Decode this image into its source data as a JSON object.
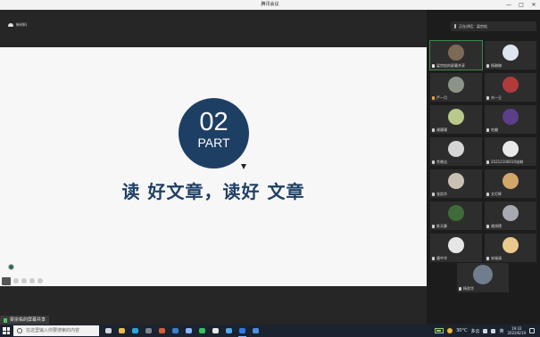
{
  "window": {
    "title": "腾讯会议",
    "controls": [
      "—",
      "□",
      "✕"
    ]
  },
  "logo": {
    "label": "新材料"
  },
  "slide": {
    "number": "02",
    "part": "PART",
    "title": "读 好文章，读好 文章"
  },
  "share_tag": {
    "label": "梁宗佑的屏幕共享"
  },
  "panel": {
    "speaking": "正在讲话：梁宗佑",
    "participants": [
      {
        "name": "梁宗佑的屏幕共享",
        "mic": "shield",
        "avatar_color": "#7c6a57",
        "active": true
      },
      {
        "name": "杨琳琳",
        "mic": "normal",
        "avatar_color": "#dfe5ee"
      },
      {
        "name": "严一月",
        "mic": "warn",
        "avatar_color": "#8c9488"
      },
      {
        "name": "刘一旦",
        "mic": "normal",
        "avatar_color": "#b33a3a"
      },
      {
        "name": "谢珊珊",
        "mic": "normal",
        "avatar_color": "#b9c98a"
      },
      {
        "name": "吃瓣",
        "mic": "normal",
        "avatar_color": "#5b3f8a"
      },
      {
        "name": "余晓洁",
        "mic": "normal",
        "avatar_color": "#d6d6d6"
      },
      {
        "name": "20212106010张琳",
        "mic": "normal",
        "avatar_color": "#e9e9e9"
      },
      {
        "name": "张凯华",
        "mic": "normal",
        "avatar_color": "#c9c2b4"
      },
      {
        "name": "文灯辉",
        "mic": "normal",
        "avatar_color": "#d2a86a"
      },
      {
        "name": "陈天静",
        "mic": "normal",
        "avatar_color": "#3f6a3a"
      },
      {
        "name": "谢润德",
        "mic": "normal",
        "avatar_color": "#a6a9b0"
      },
      {
        "name": "唐中华",
        "mic": "normal",
        "avatar_color": "#e6e6e6"
      },
      {
        "name": "宋瑞清",
        "mic": "normal",
        "avatar_color": "#e9c98e"
      },
      {
        "name": "杨思华",
        "mic": "normal",
        "avatar_color": "#6f7d8c"
      }
    ]
  },
  "taskbar": {
    "search_placeholder": "在这里输入你要搜索的内容",
    "apps": [
      {
        "icon": "task-view-icon",
        "color": "#cfd6e0",
        "on": false
      },
      {
        "icon": "file-explorer-icon",
        "color": "#e8bf4a",
        "on": false
      },
      {
        "icon": "edge-icon",
        "color": "#2aa6d9",
        "on": false
      },
      {
        "icon": "settings-icon",
        "color": "#7c8591",
        "on": false
      },
      {
        "icon": "chrome-icon",
        "color": "#e05a3a",
        "on": false
      },
      {
        "icon": "store-icon",
        "color": "#3b7fd0",
        "on": false
      },
      {
        "icon": "photos-icon",
        "color": "#8fb3ff",
        "on": false
      },
      {
        "icon": "wechat-icon",
        "color": "#35c35a",
        "on": false
      },
      {
        "icon": "app-icon",
        "color": "#e8e8e8",
        "on": false
      },
      {
        "icon": "game-icon",
        "color": "#56a8e6",
        "on": false
      },
      {
        "icon": "meeting-icon",
        "color": "#2d7bf0",
        "on": true
      },
      {
        "icon": "mail-icon",
        "color": "#4a8fe0",
        "on": false
      }
    ],
    "temperature": "30°C",
    "weather": "多云",
    "ime": "英",
    "time": "19:32",
    "date": "2022/6/19"
  },
  "colors": {
    "accent": "#1e3f64",
    "panel": "#1c1c1c",
    "active_tile": "#3a8a4a"
  }
}
